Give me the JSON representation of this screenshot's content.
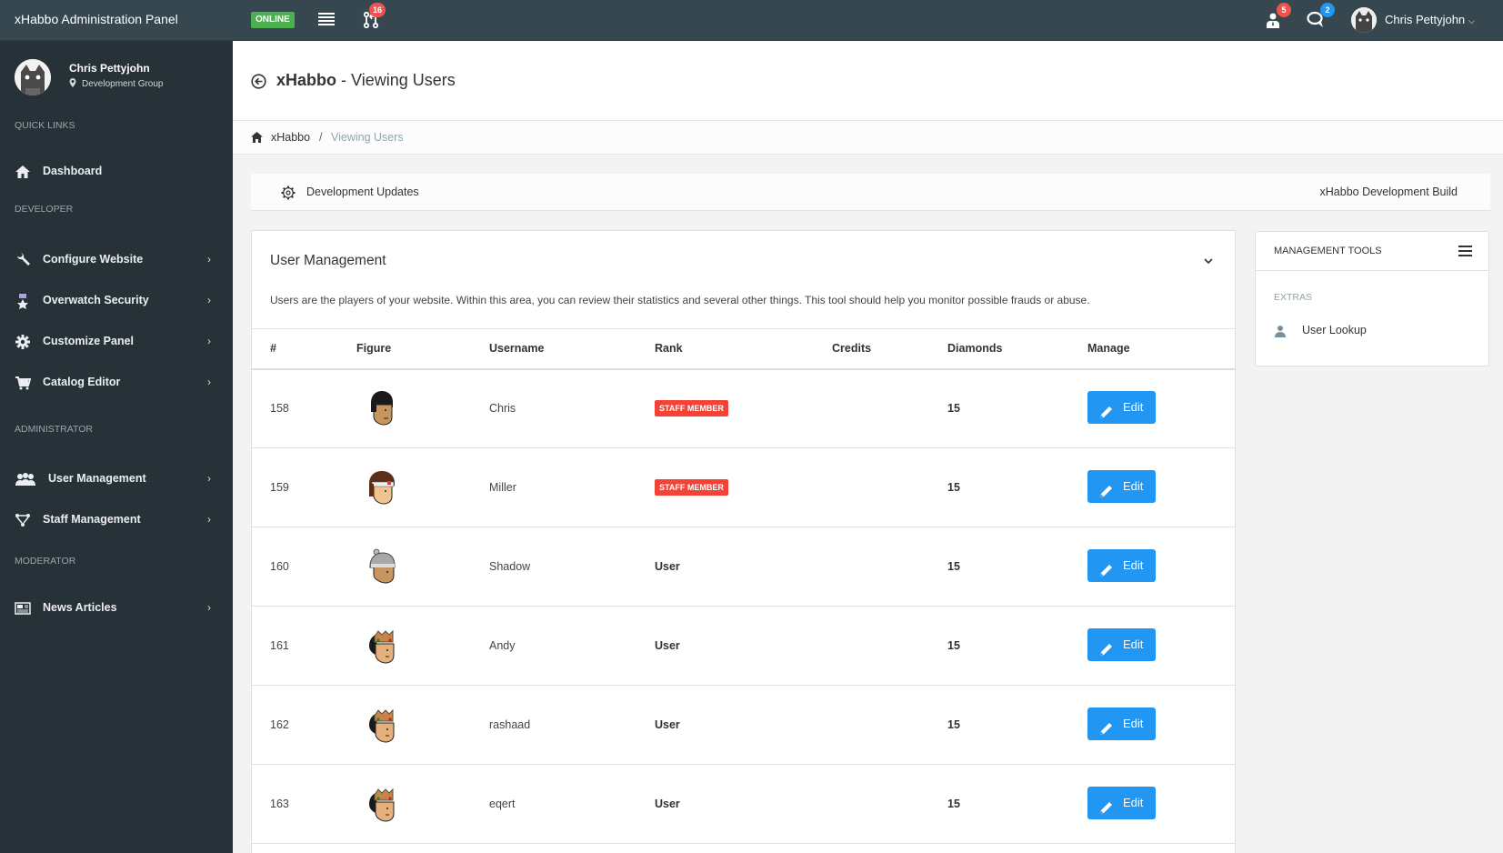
{
  "topbar": {
    "brand": "xHabbo Administration Panel",
    "status_badge": "ONLINE",
    "git_count": "16",
    "user_alert_count": "5",
    "chat_count": "2",
    "username": "Chris Pettyjohn",
    "chevron": "⌄",
    "colors": {
      "bg": "#37474f",
      "online": "#4caf50",
      "red_badge": "#ef5350",
      "blue_badge": "#2196f3"
    }
  },
  "sidebar": {
    "profile": {
      "name": "Chris Pettyjohn",
      "group": "Development Group"
    },
    "sections": [
      {
        "title": "Quick Links",
        "items": [
          {
            "label": "Dashboard",
            "icon": "home-icon",
            "has_submenu": false
          }
        ]
      },
      {
        "title": "Developer",
        "items": [
          {
            "label": "Configure Website",
            "icon": "wrench-icon",
            "has_submenu": true
          },
          {
            "label": "Overwatch Security",
            "icon": "medal-icon",
            "has_submenu": true
          },
          {
            "label": "Customize Panel",
            "icon": "gear-icon",
            "has_submenu": true
          },
          {
            "label": "Catalog Editor",
            "icon": "cart-icon",
            "has_submenu": true
          }
        ]
      },
      {
        "title": "Administrator",
        "items": [
          {
            "label": "User Management",
            "icon": "users-icon",
            "has_submenu": true
          },
          {
            "label": "Staff Management",
            "icon": "staff-icon",
            "has_submenu": true
          }
        ]
      },
      {
        "title": "Moderator",
        "items": [
          {
            "label": "News Articles",
            "icon": "newspaper-icon",
            "has_submenu": true
          }
        ]
      }
    ],
    "arrow": "›"
  },
  "header": {
    "title_bold": "xHabbo",
    "title_rest": " - Viewing Users"
  },
  "breadcrumb": {
    "home": "xHabbo",
    "separator": "/",
    "current": "Viewing Users"
  },
  "devbar": {
    "left_label": "Development Updates",
    "right_label": "xHabbo Development Build"
  },
  "card": {
    "title": "User Management",
    "description": "Users are the players of your website. Within this area, you can review their statistics and several other things. This tool should help you monitor possible frauds or abuse.",
    "columns": [
      "#",
      "Figure",
      "Username",
      "Rank",
      "Credits",
      "Diamonds",
      "Manage"
    ],
    "edit_label": "Edit",
    "rows": [
      {
        "id": "158",
        "username": "Chris",
        "rank": "STAFF MEMBER",
        "rank_type": "staff",
        "credits": "",
        "diamonds": "15",
        "figure": "black-hair"
      },
      {
        "id": "159",
        "username": "Miller",
        "rank": "STAFF MEMBER",
        "rank_type": "staff",
        "credits": "",
        "diamonds": "15",
        "figure": "headband"
      },
      {
        "id": "160",
        "username": "Shadow",
        "rank": "User",
        "rank_type": "user",
        "credits": "",
        "diamonds": "15",
        "figure": "beanie"
      },
      {
        "id": "161",
        "username": "Andy",
        "rank": "User",
        "rank_type": "user",
        "credits": "",
        "diamonds": "15",
        "figure": "crown"
      },
      {
        "id": "162",
        "username": "rashaad",
        "rank": "User",
        "rank_type": "user",
        "credits": "",
        "diamonds": "15",
        "figure": "crown"
      },
      {
        "id": "163",
        "username": "eqert",
        "rank": "User",
        "rank_type": "user",
        "credits": "",
        "diamonds": "15",
        "figure": "crown"
      }
    ],
    "colors": {
      "staff_badge": "#f44336",
      "edit_button": "#2196f3"
    }
  },
  "tools": {
    "title": "Management Tools",
    "section": "Extras",
    "items": [
      {
        "label": "User Lookup",
        "icon": "user-icon"
      }
    ]
  }
}
